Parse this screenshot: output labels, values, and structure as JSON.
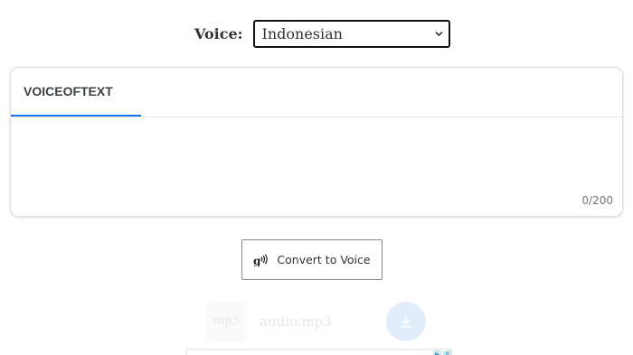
{
  "voice": {
    "label": "Voice:",
    "selected": "Indonesian"
  },
  "editor": {
    "tab_label": "VOICEOFTEXT",
    "text": "",
    "char_count": "0/200"
  },
  "convert": {
    "label": "Convert to Voice",
    "icon": "speaking-head-icon"
  },
  "result": {
    "file_type": "mp3",
    "file_name": "audio.mp3",
    "download_icon": "download-icon"
  },
  "ad": {
    "info_icon": "ad-choices-icon",
    "close_icon": "close-icon",
    "close_glyph": "✕"
  },
  "colors": {
    "accent": "#1a73e8"
  }
}
